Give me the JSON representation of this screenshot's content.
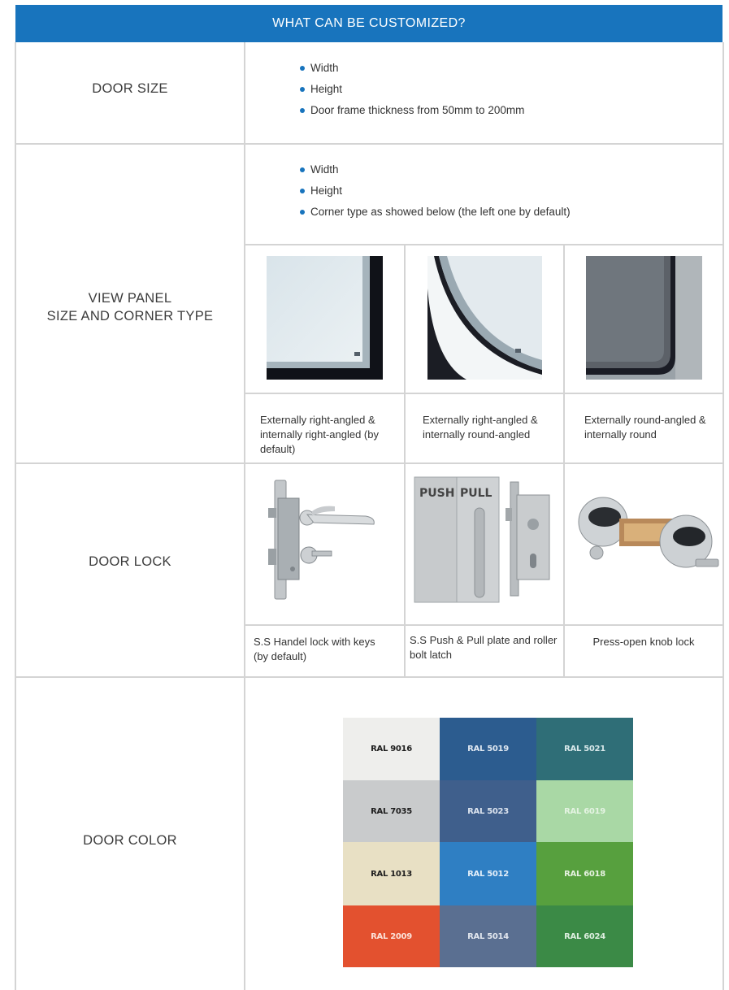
{
  "header": {
    "title": "WHAT CAN BE CUSTOMIZED?"
  },
  "door_size": {
    "label": "DOOR SIZE",
    "items": [
      "Width",
      "Height",
      "Door frame thickness from 50mm to 200mm"
    ]
  },
  "view_panel": {
    "label_line1": "VIEW PANEL",
    "label_line2": "SIZE AND CORNER TYPE",
    "items": [
      "Width",
      "Height",
      "Corner type as showed below (the left one by default)"
    ],
    "options": [
      {
        "caption": "Externally right-angled & internally right-angled (by default)"
      },
      {
        "caption": "Externally right-angled & internally round-angled"
      },
      {
        "caption": "Externally round-angled & internally round"
      }
    ]
  },
  "door_lock": {
    "label": "DOOR LOCK",
    "options": [
      {
        "caption": "S.S Handel lock with keys (by default)"
      },
      {
        "caption": "S.S Push & Pull plate and roller bolt latch",
        "push_text": "PUSH",
        "pull_text": "PULL"
      },
      {
        "caption": "Press-open knob lock"
      }
    ]
  },
  "door_color": {
    "label": "DOOR COLOR",
    "swatches": [
      {
        "code": "RAL 9016",
        "color": "#eeeeec",
        "text_color": "#1e1e1e"
      },
      {
        "code": "RAL 5019",
        "color": "#2c5c8f",
        "text_color": "#dde6f0"
      },
      {
        "code": "RAL 5021",
        "color": "#2f6e77",
        "text_color": "#d8e8ea"
      },
      {
        "code": "RAL 7035",
        "color": "#c9cbcc",
        "text_color": "#1e1e1e"
      },
      {
        "code": "RAL 5023",
        "color": "#3f5f8c",
        "text_color": "#dbe3ee"
      },
      {
        "code": "RAL 6019",
        "color": "#a9d8a5",
        "text_color": "#e4f3e2"
      },
      {
        "code": "RAL 1013",
        "color": "#e8e0c4",
        "text_color": "#1e1e1e"
      },
      {
        "code": "RAL 5012",
        "color": "#2f7fc3",
        "text_color": "#e2eef9"
      },
      {
        "code": "RAL 6018",
        "color": "#57a03e",
        "text_color": "#e6f2e0"
      },
      {
        "code": "RAL 2009",
        "color": "#e3512f",
        "text_color": "#fbe1d8"
      },
      {
        "code": "RAL 5014",
        "color": "#5a6f91",
        "text_color": "#e1e6ee"
      },
      {
        "code": "RAL 6024",
        "color": "#3b8a46",
        "text_color": "#ddeedf"
      }
    ]
  }
}
